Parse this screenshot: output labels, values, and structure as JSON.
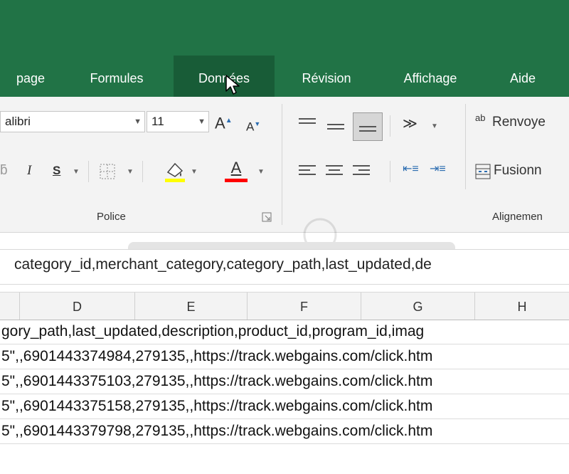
{
  "tabs": [
    {
      "label": "page",
      "active": false
    },
    {
      "label": "Formules",
      "active": false
    },
    {
      "label": "Données",
      "active": true
    },
    {
      "label": "Révision",
      "active": false
    },
    {
      "label": "Affichage",
      "active": false
    },
    {
      "label": "Aide",
      "active": false
    }
  ],
  "ribbon": {
    "font_name": "alibri",
    "font_size": "11",
    "grow_font": "A",
    "shrink_font": "A",
    "italic": "I",
    "underline": "S",
    "font_color": "A",
    "police_label": "Police",
    "wrap_text_label": "Renvoye",
    "wrap_icon": "ab",
    "merge_label": "Fusionn",
    "alignment_label": "Alignemen"
  },
  "formula_bar": {
    "text": "category_id,merchant_category,category_path,last_updated,de"
  },
  "columns": [
    "D",
    "E",
    "F",
    "G",
    "H"
  ],
  "rows": [
    "gory_path,last_updated,description,product_id,program_id,imag",
    "5\",,6901443374984,279135,,https://track.webgains.com/click.htm",
    "5\",,6901443375103,279135,,https://track.webgains.com/click.htm",
    "5\",,6901443375158,279135,,https://track.webgains.com/click.htm",
    "5\",,6901443379798,279135,,https://track.webgains.com/click.htm"
  ],
  "colors": {
    "excel_green": "#217346",
    "active_tab": "#185c37",
    "highlight_yellow": "#ffff00",
    "font_red": "#ff0000"
  }
}
